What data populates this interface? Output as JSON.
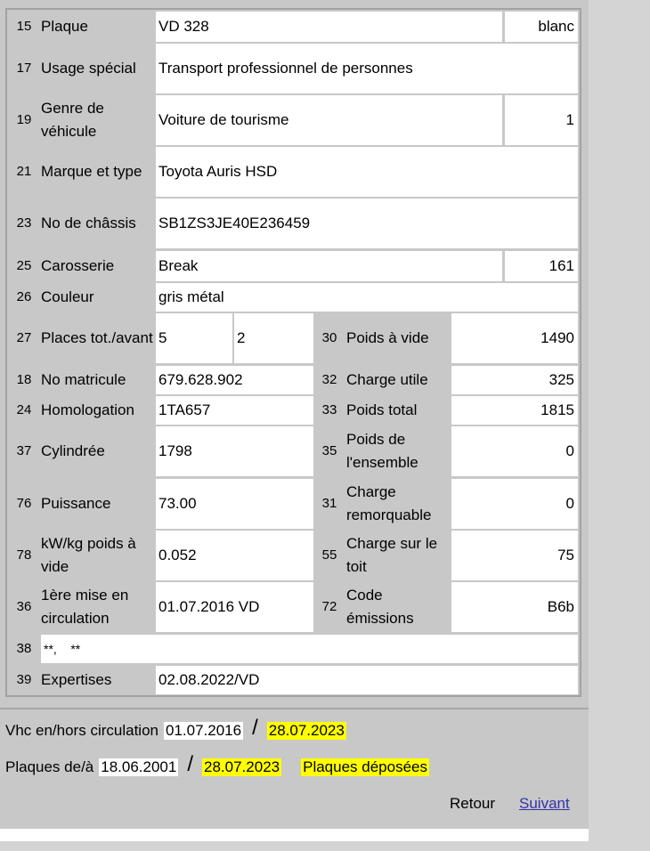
{
  "rows": {
    "r15": {
      "num": "15",
      "label": "Plaque",
      "value": "VD 328",
      "extra": "blanc"
    },
    "r17": {
      "num": "17",
      "label": "Usage spécial",
      "value": "Transport professionnel de personnes"
    },
    "r19": {
      "num": "19",
      "label": "Genre de véhicule",
      "value": "Voiture de tourisme",
      "extra": "1"
    },
    "r21": {
      "num": "21",
      "label": "Marque et type",
      "value": "Toyota Auris HSD"
    },
    "r23": {
      "num": "23",
      "label": "No de châssis",
      "value": "SB1ZS3JE40E236459"
    },
    "r25": {
      "num": "25",
      "label": "Carosserie",
      "value": "Break",
      "extra": "161"
    },
    "r26": {
      "num": "26",
      "label": "Couleur",
      "value": "gris métal"
    },
    "r27": {
      "num": "27",
      "label": "Places tot./avant",
      "value": "5",
      "value2": "2"
    },
    "r30": {
      "num": "30",
      "label": "Poids à vide",
      "value": "1490"
    },
    "r18": {
      "num": "18",
      "label": "No matricule",
      "value": "679.628.902"
    },
    "r32": {
      "num": "32",
      "label": "Charge utile",
      "value": "325"
    },
    "r24": {
      "num": "24",
      "label": "Homologation",
      "value": "1TA657"
    },
    "r33": {
      "num": "33",
      "label": "Poids total",
      "value": "1815"
    },
    "r37": {
      "num": "37",
      "label": "Cylindrée",
      "value": "1798"
    },
    "r35": {
      "num": "35",
      "label": "Poids de l'ensemble",
      "value": "0"
    },
    "r76": {
      "num": "76",
      "label": "Puissance",
      "value": "73.00"
    },
    "r31": {
      "num": "31",
      "label": "Charge remorquable",
      "value": "0"
    },
    "r78": {
      "num": "78",
      "label": "kW/kg poids à vide",
      "value": "0.052"
    },
    "r55": {
      "num": "55",
      "label": "Charge sur le toit",
      "value": "75"
    },
    "r36": {
      "num": "36",
      "label": "1ère mise en circulation",
      "value": "01.07.2016 VD"
    },
    "r72": {
      "num": "72",
      "label": "Code émissions",
      "value": "B6b"
    },
    "r38": {
      "num": "38",
      "value": "**,    **"
    },
    "r39": {
      "num": "39",
      "label": "Expertises",
      "value": "02.08.2022/VD"
    }
  },
  "footer": {
    "circ_label": "Vhc en/hors circulation",
    "circ_from": "01.07.2016",
    "circ_to": "28.07.2023",
    "plates_label": "Plaques de/à",
    "plates_from": "18.06.2001",
    "plates_to": "28.07.2023",
    "plates_status": "Plaques déposées",
    "slash": "/",
    "back": "Retour",
    "next": "Suivant"
  },
  "colors": {
    "highlight": "#ffff00",
    "link": "#3333aa"
  }
}
